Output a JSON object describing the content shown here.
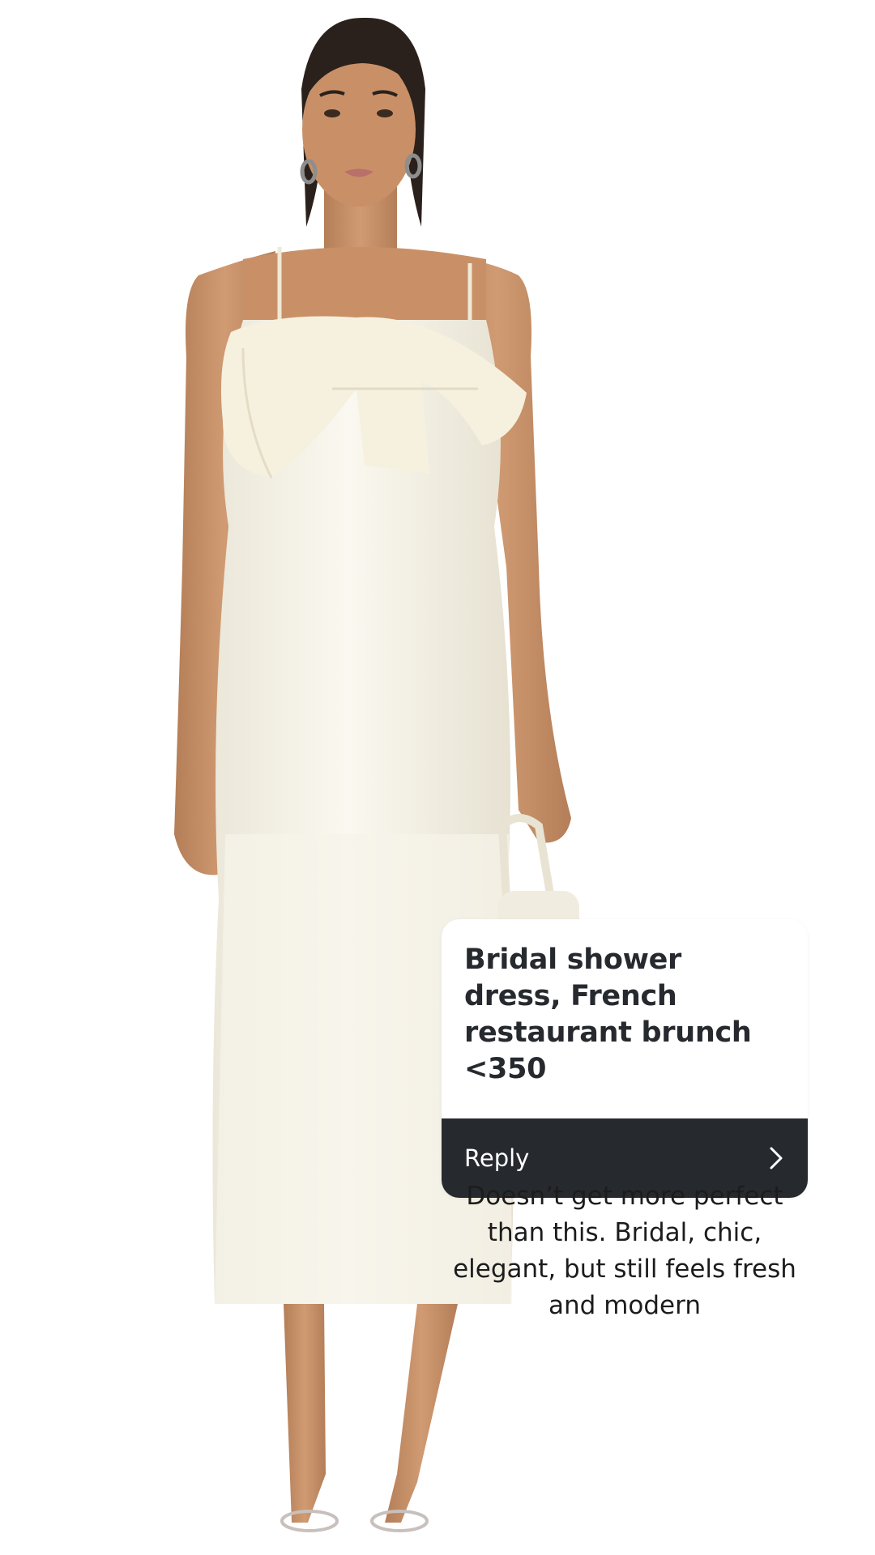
{
  "question_card": {
    "question_text": "Bridal shower dress, French restaurant brunch <350",
    "reply_label": "Reply",
    "reply_icon": "chevron-right-icon"
  },
  "caption": {
    "text": "Doesn’t get more perfect than this. Bridal, chic, elegant, but still feels fresh and modern"
  },
  "colors": {
    "background": "#ffffff",
    "card_bg": "#ffffff",
    "reply_bar_bg": "#262a2f",
    "question_text": "#262a2f",
    "reply_text": "#ffffff",
    "dress": "#f4f1e6",
    "skin": "#c58e66",
    "hair": "#2b211c"
  }
}
